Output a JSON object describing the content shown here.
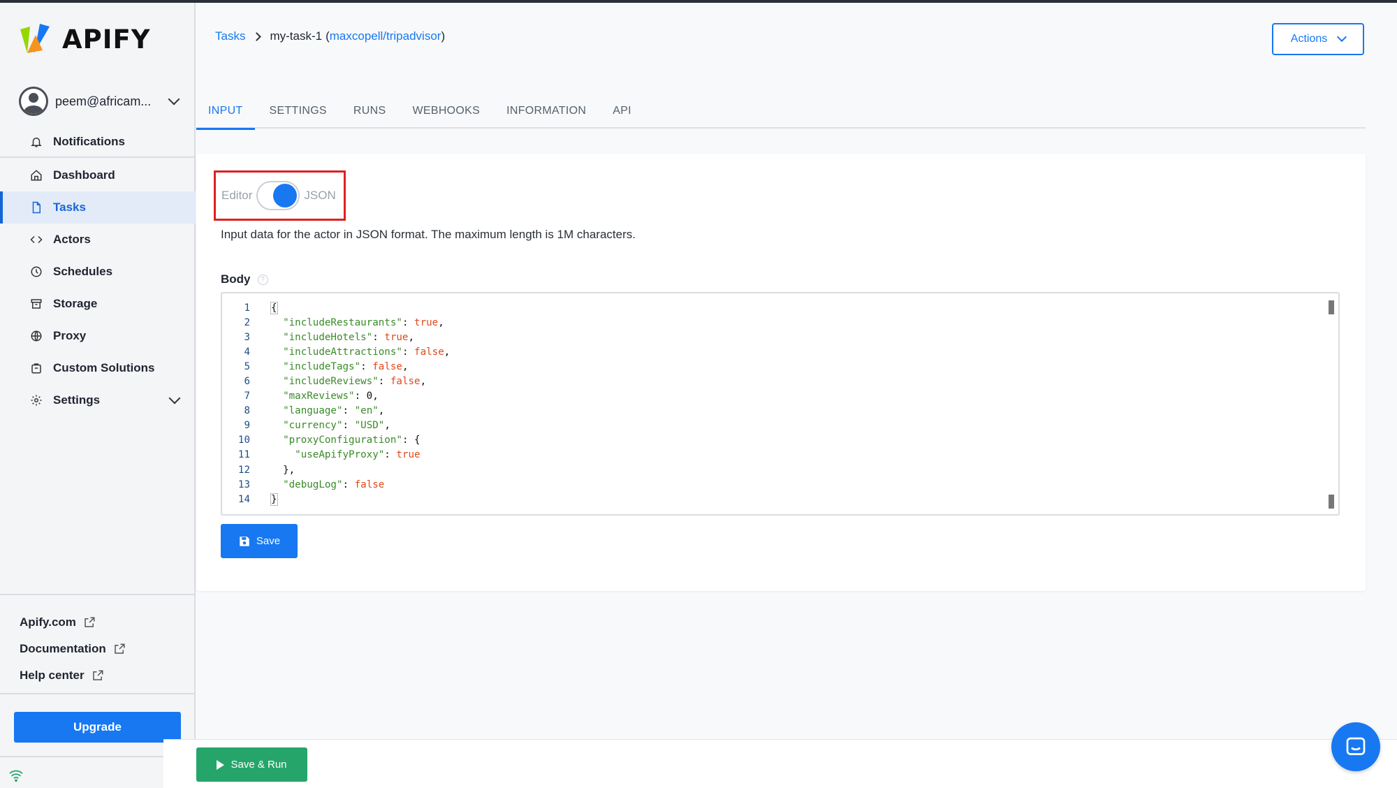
{
  "app": {
    "brand": "APIFY",
    "brand_colors": {
      "orange": "#f7941d",
      "green": "#97d700",
      "blue": "#1778f2"
    }
  },
  "sidebar": {
    "user": "peem@africam...",
    "items": [
      {
        "label": "Notifications",
        "icon": "bell-icon"
      },
      {
        "label": "Dashboard",
        "icon": "home-icon"
      },
      {
        "label": "Tasks",
        "icon": "document-icon",
        "active": true
      },
      {
        "label": "Actors",
        "icon": "code-icon"
      },
      {
        "label": "Schedules",
        "icon": "clock-icon"
      },
      {
        "label": "Storage",
        "icon": "archive-icon"
      },
      {
        "label": "Proxy",
        "icon": "globe-icon"
      },
      {
        "label": "Custom Solutions",
        "icon": "bag-icon"
      },
      {
        "label": "Settings",
        "icon": "gear-icon"
      }
    ],
    "external_links": [
      "Apify.com",
      "Documentation",
      "Help center"
    ],
    "upgrade_label": "Upgrade"
  },
  "breadcrumb": {
    "root": "Tasks",
    "task": "my-task-1",
    "open_paren": "(",
    "actor": "maxcopell/tripadvisor",
    "close_paren": ")"
  },
  "header": {
    "actions_label": "Actions"
  },
  "tabs": [
    "INPUT",
    "SETTINGS",
    "RUNS",
    "WEBHOOKS",
    "INFORMATION",
    "API"
  ],
  "input": {
    "toggle_left": "Editor",
    "toggle_right": "JSON",
    "toggle_state": "JSON",
    "description": "Input data for the actor in JSON format. The maximum length is 1M characters.",
    "body_label": "Body",
    "save_label": "Save",
    "code_lines": [
      "{",
      "  \"includeRestaurants\": true,",
      "  \"includeHotels\": true,",
      "  \"includeAttractions\": false,",
      "  \"includeTags\": false,",
      "  \"includeReviews\": false,",
      "  \"maxReviews\": 0,",
      "  \"language\": \"en\",",
      "  \"currency\": \"USD\",",
      "  \"proxyConfiguration\": {",
      "    \"useApifyProxy\": true",
      "  },",
      "  \"debugLog\": false",
      "}"
    ]
  },
  "footer": {
    "save_run_label": "Save & Run"
  }
}
